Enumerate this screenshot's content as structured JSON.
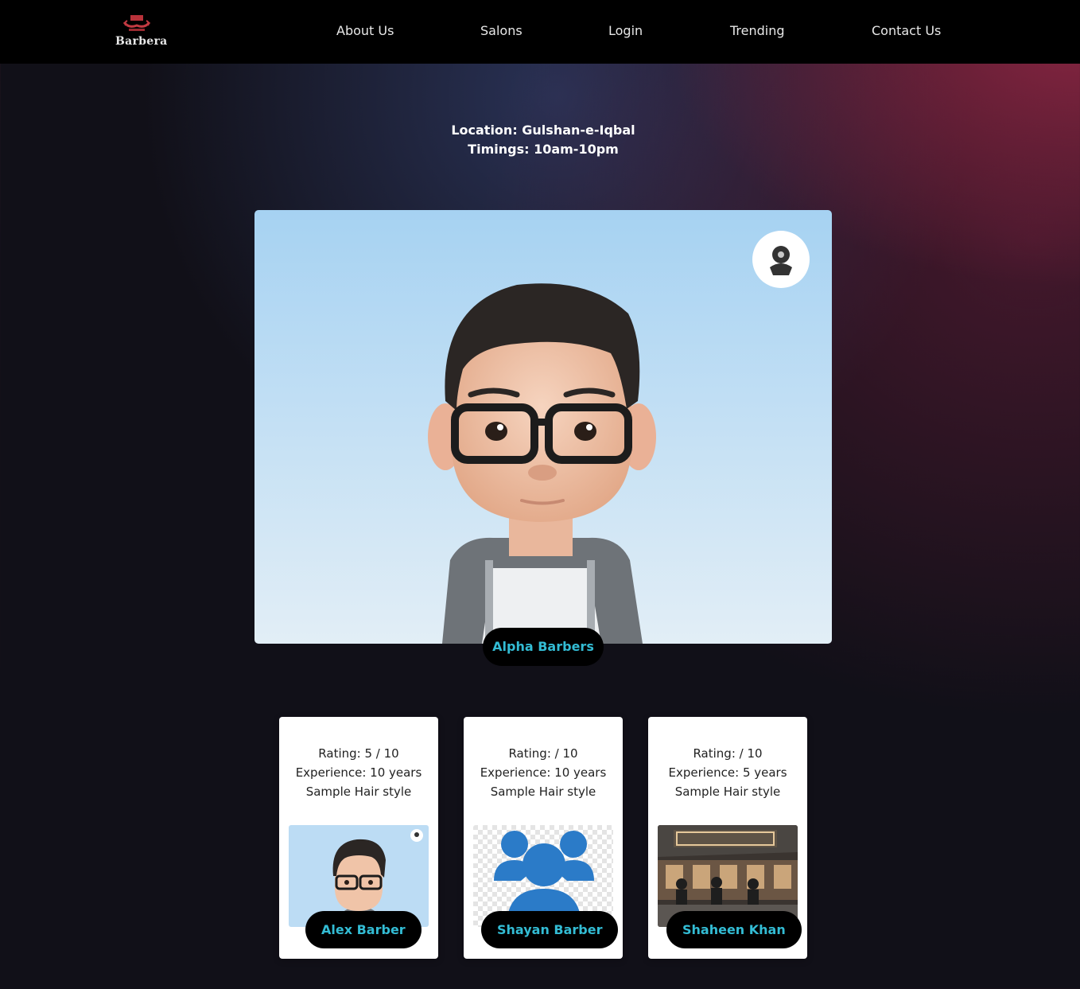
{
  "brand": {
    "name": "Barbera"
  },
  "nav": {
    "items": [
      {
        "label": "About Us"
      },
      {
        "label": "Salons"
      },
      {
        "label": "Login"
      },
      {
        "label": "Trending"
      },
      {
        "label": "Contact Us"
      }
    ]
  },
  "salon": {
    "location": "Location: Gulshan-e-Iqbal",
    "timings": "Timings: 10am-10pm",
    "name": "Alpha Barbers"
  },
  "barbers": [
    {
      "rating": "Rating: 5 / 10",
      "experience": "Experience: 10 years",
      "style": "Sample Hair style",
      "name": "Alex Barber"
    },
    {
      "rating": "Rating: / 10",
      "experience": "Experience: 10 years",
      "style": "Sample Hair style",
      "name": "Shayan Barber"
    },
    {
      "rating": "Rating: / 10",
      "experience": "Experience: 5 years",
      "style": "Sample Hair style",
      "name": "Shaheen Khan"
    }
  ],
  "colors": {
    "accent": "#33bcd4",
    "navbar": "#000000",
    "card": "#ffffff"
  },
  "icons": [
    "barber-logo-icon",
    "avatar-badge-icon",
    "group-users-icon"
  ]
}
